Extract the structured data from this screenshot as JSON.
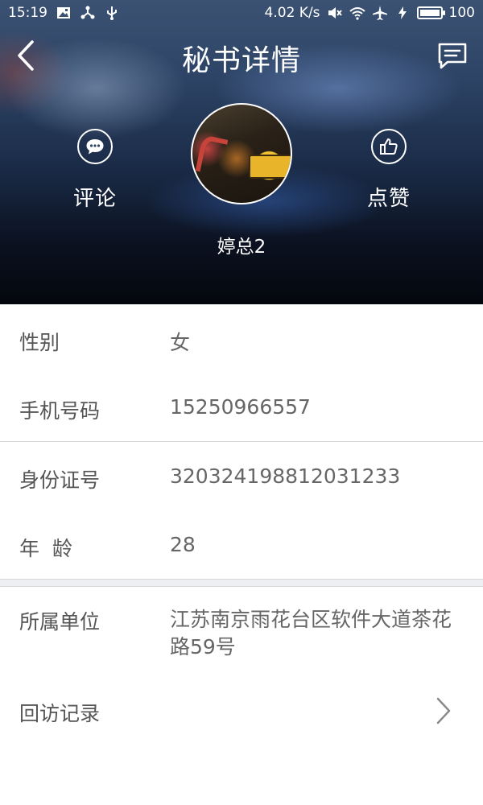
{
  "status_bar": {
    "time": "15:19",
    "net_speed": "4.02 K/s",
    "battery": "100",
    "battery_level": 1.0
  },
  "header": {
    "title": "秘书详情",
    "back_icon": "chevron-left-icon",
    "message_icon": "message-square-icon"
  },
  "profile": {
    "name": "婷总2",
    "comment_label": "评论",
    "comment_icon": "comment-bubble-icon",
    "like_label": "点赞",
    "like_icon": "thumbs-up-icon"
  },
  "details": {
    "gender": {
      "label": "性别",
      "value": "女"
    },
    "phone": {
      "label": "手机号码",
      "value": "15250966557"
    },
    "id_number": {
      "label": "身份证号",
      "value": "320324198812031233"
    },
    "age": {
      "label": "年  龄",
      "value": "28"
    },
    "company": {
      "label": "所属单位",
      "value": "江苏南京雨花台区软件大道茶花路59号"
    },
    "visit_record": {
      "label": "回访记录"
    }
  },
  "colors": {
    "label_text": "#555555",
    "value_text": "#666666",
    "divider": "#d6d6d6",
    "section_gap": "#eeeff2"
  }
}
